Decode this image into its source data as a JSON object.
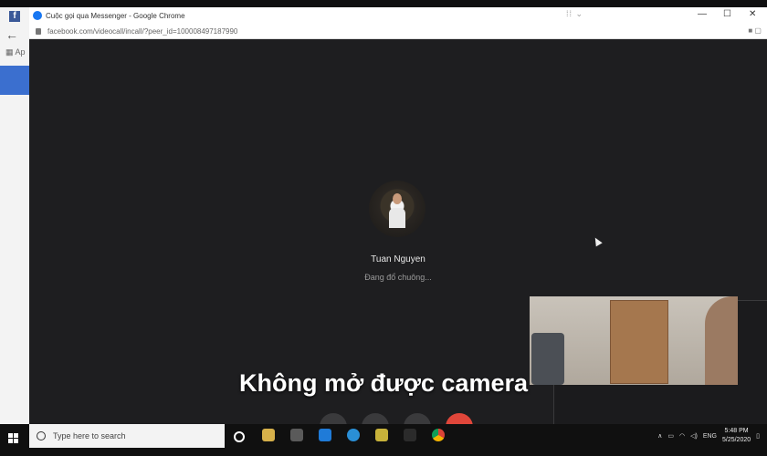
{
  "browser": {
    "window_title": "Cuộc gọi qua Messenger - Google Chrome",
    "url": "facebook.com/videocall/incall/?peer_id=100008497187990",
    "background_tab_label": "Ap"
  },
  "call": {
    "caller_name": "Tuan Nguyen",
    "status": "Đang đổ chuông..."
  },
  "caption": "Không mở được camera",
  "taskbar": {
    "search_placeholder": "Type here to search",
    "language": "ENG",
    "time": "5:48 PM",
    "date": "5/25/2020"
  },
  "colors": {
    "call_bg": "#1e1e20",
    "end_call": "#e0463a",
    "messenger": "#1877f2"
  }
}
